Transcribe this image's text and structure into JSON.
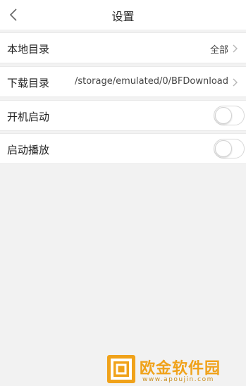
{
  "header": {
    "title": "设置",
    "back_icon": "chevron-left-icon"
  },
  "settings": {
    "local_dir": {
      "label": "本地目录",
      "value": "全部"
    },
    "download_dir": {
      "label": "下载目录",
      "value": "/storage/emulated/0/BFDownload"
    },
    "auto_start": {
      "label": "开机启动",
      "enabled": false
    },
    "auto_play": {
      "label": "启动播放",
      "enabled": false
    }
  },
  "watermark": {
    "brand": "欧金软件园",
    "url": "www.apoujin.com"
  },
  "colors": {
    "background": "#f2f2f2",
    "surface": "#ffffff",
    "watermark": "#f0a21a"
  }
}
